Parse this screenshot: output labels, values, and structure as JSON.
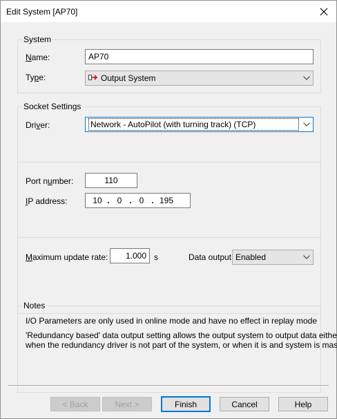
{
  "window": {
    "title": "Edit System [AP70]"
  },
  "system_group": {
    "title": "System",
    "name_label_accel": "N",
    "name_label_rest": "ame:",
    "name_value": "AP70",
    "type_label_pre": "Ty",
    "type_label_accel": "p",
    "type_label_post": "e:",
    "type_value": "Output System",
    "type_icon": "output-system-icon"
  },
  "socket_group": {
    "title": "Socket Settings",
    "driver_label_pre": "Dri",
    "driver_label_accel": "v",
    "driver_label_post": "er:",
    "driver_value": "Network - AutoPilot (with turning track) (TCP)",
    "port_label_pre": "Port n",
    "port_label_accel": "u",
    "port_label_post": "mber:",
    "port_value": "110",
    "ip_label_accel": "I",
    "ip_label_rest": "P address:",
    "ip_octets": [
      "10",
      "0",
      "0",
      "195"
    ],
    "rate_label_accel": "M",
    "rate_label_rest": "aximum update rate:",
    "rate_value": "1.000",
    "rate_unit": "s",
    "data_output_label": "Data output:",
    "data_output_value": "Enabled"
  },
  "notes_group": {
    "title": "Notes",
    "line1": "I/O Parameters are only used in online mode and have no effect in replay mode",
    "line2": "'Redundancy based' data output setting allows the output system to output data either",
    "line3": "when the redundancy driver is not part of the system, or when it is and system is master"
  },
  "buttons": {
    "back": "< Back",
    "next": "Next >",
    "finish": "Finish",
    "cancel": "Cancel",
    "help": "Help"
  }
}
